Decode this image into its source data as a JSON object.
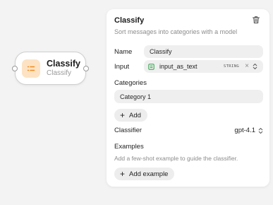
{
  "node": {
    "title": "Classify",
    "subtitle": "Classify",
    "icon": "classify-list-icon",
    "icon_bg": "#fde3c4",
    "icon_color": "#f08a1c"
  },
  "panel": {
    "title": "Classify",
    "description": "Sort messages into categories with a model",
    "delete_icon": "trash-icon",
    "name": {
      "label": "Name",
      "value": "Classify"
    },
    "input": {
      "label": "Input",
      "variable": "input_as_text",
      "type": "STRING",
      "clear": "×",
      "variable_icon": "variable-icon",
      "icon_color": "#2fa24a"
    },
    "categories": {
      "label": "Categories",
      "items": [
        "Category 1"
      ],
      "add_label": "Add"
    },
    "classifier": {
      "label": "Classifier",
      "value": "gpt-4.1"
    },
    "examples": {
      "label": "Examples",
      "hint": "Add a few-shot example to guide the classifier.",
      "add_label": "Add example"
    }
  }
}
